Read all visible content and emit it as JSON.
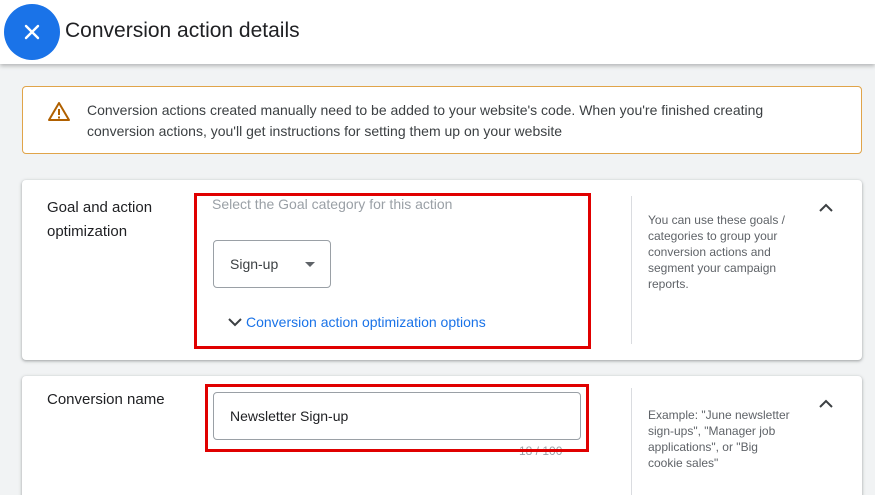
{
  "header": {
    "close_icon": "close-icon",
    "title": "Conversion action details"
  },
  "banner": {
    "icon": "warning-icon",
    "text": "Conversion actions created manually need to be added to your website's code. When you're finished creating conversion actions, you'll get instructions for setting them up on your website",
    "border_color": "#e0a449"
  },
  "goal_section": {
    "label": "Goal and action optimization",
    "hint": "Select the Goal category for this action",
    "category_select": {
      "value": "Sign-up"
    },
    "optimization_link": "Conversion action optimization options",
    "help_text": "You can use these goals / categories to group your conversion actions and segment your campaign reports."
  },
  "name_section": {
    "label": "Conversion name",
    "input_value": "Newsletter Sign-up",
    "char_count": "18 / 100",
    "help_text": "Example: \"June newsletter sign-ups\", \"Manager job applications\", or \"Big cookie sales\""
  },
  "colors": {
    "accent": "#1a73e8",
    "highlight": "#e00000"
  }
}
